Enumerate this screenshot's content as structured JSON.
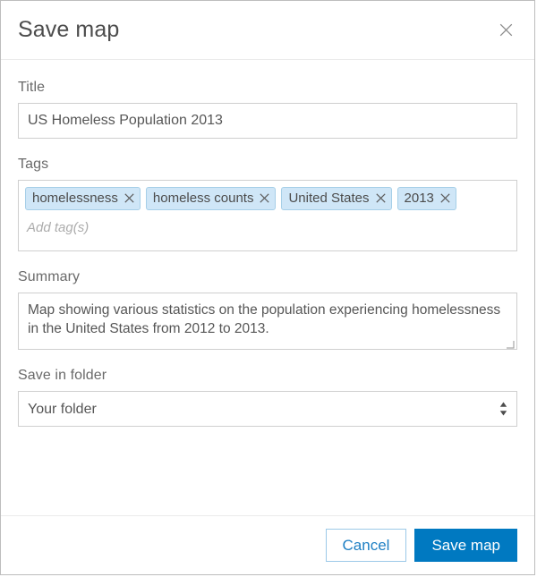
{
  "dialog": {
    "title": "Save map",
    "close_icon": "close-icon"
  },
  "title_field": {
    "label": "Title",
    "value": "US Homeless Population 2013",
    "placeholder": ""
  },
  "tags_field": {
    "label": "Tags",
    "placeholder": "Add tag(s)",
    "remove_icon": "close-icon",
    "tags": [
      {
        "label": "homelessness"
      },
      {
        "label": "homeless counts"
      },
      {
        "label": "United States"
      },
      {
        "label": "2013"
      }
    ]
  },
  "summary_field": {
    "label": "Summary",
    "value": "Map showing various statistics on the population experiencing homelessness in the United States from 2012 to 2013.",
    "placeholder": "",
    "resize_icon": "resize-handle-icon"
  },
  "folder_field": {
    "label": "Save in folder",
    "selected": "Your folder",
    "options": [
      "Your folder"
    ],
    "stepper_icon": "sort-arrows-icon"
  },
  "footer": {
    "cancel_label": "Cancel",
    "save_label": "Save map"
  },
  "colors": {
    "primary": "#0079c1",
    "primary_border": "#9cc9e8",
    "tag_fill": "#cfe6f7",
    "tag_border": "#a6cfe8",
    "label_text": "#6a6a6a",
    "input_border": "#cfcfcf"
  }
}
